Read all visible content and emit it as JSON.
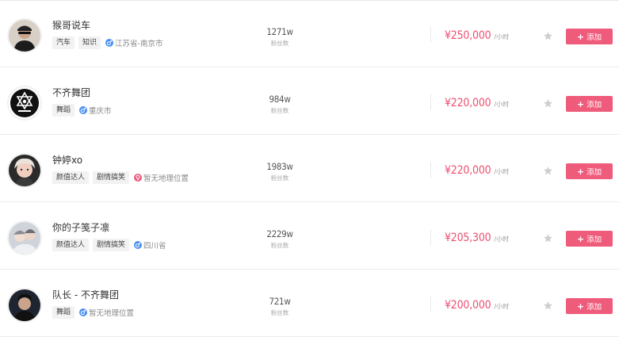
{
  "list": {
    "rows": [
      {
        "name": "猴哥说车",
        "tags": [
          "汽车",
          "知识"
        ],
        "location": "江苏省-南京市",
        "location_type": "gender-icon",
        "fans": "1271w",
        "fans_label": "粉丝数",
        "price": "¥250,000",
        "price_unit": "/小时",
        "add_label": "添加",
        "plus": "+"
      },
      {
        "name": "不齐舞团",
        "tags": [
          "舞蹈"
        ],
        "location": "重庆市",
        "location_type": "gender-icon",
        "fans": "984w",
        "fans_label": "粉丝数",
        "price": "¥220,000",
        "price_unit": "/小时",
        "add_label": "添加",
        "plus": "+"
      },
      {
        "name": "钟婷xo",
        "tags": [
          "颜值达人",
          "剧情搞笑"
        ],
        "location": "暂无地理位置",
        "location_type": "female-icon",
        "fans": "1983w",
        "fans_label": "粉丝数",
        "price": "¥220,000",
        "price_unit": "/小时",
        "add_label": "添加",
        "plus": "+"
      },
      {
        "name": "你的子笺子凛",
        "tags": [
          "颜值达人",
          "剧情搞笑"
        ],
        "location": "四川省",
        "location_type": "gender-icon",
        "fans": "2229w",
        "fans_label": "粉丝数",
        "price": "¥205,300",
        "price_unit": "/小时",
        "add_label": "添加",
        "plus": "+"
      },
      {
        "name": "队长 - 不齐舞团",
        "tags": [
          "舞蹈"
        ],
        "location": "暂无地理位置",
        "location_type": "gender-icon",
        "fans": "721w",
        "fans_label": "粉丝数",
        "price": "¥200,000",
        "price_unit": "/小时",
        "add_label": "添加",
        "plus": "+"
      }
    ]
  },
  "colors": {
    "accent": "#ef5b7b",
    "price": "#ee4d6e",
    "male_icon": "#4a8ff0",
    "female_icon": "#ee5a7a",
    "star": "#cfcfcf"
  }
}
